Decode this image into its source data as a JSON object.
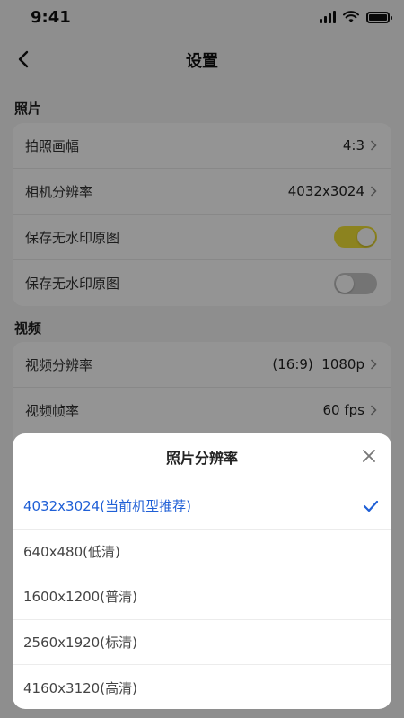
{
  "status_bar": {
    "time": "9:41"
  },
  "nav": {
    "title": "设置"
  },
  "photo_section": {
    "title": "照片",
    "rows": [
      {
        "label": "拍照画幅",
        "value": "4:3"
      },
      {
        "label": "相机分辨率",
        "value": "4032x3024"
      },
      {
        "label": "保存无水印原图",
        "toggle": "on"
      },
      {
        "label": "保存无水印原图",
        "toggle": "off"
      }
    ]
  },
  "video_section": {
    "title": "视频",
    "rows": [
      {
        "label": "视频分辨率",
        "value": "(16:9)  1080p"
      },
      {
        "label": "视频帧率",
        "value": "60 fps"
      }
    ]
  },
  "sheet": {
    "title": "照片分辨率",
    "options": [
      {
        "label": "4032x3024(当前机型推荐)",
        "selected": true
      },
      {
        "label": "640x480(低清)",
        "selected": false
      },
      {
        "label": "1600x1200(普清)",
        "selected": false
      },
      {
        "label": "2560x1920(标清)",
        "selected": false
      },
      {
        "label": "4160x3120(高清)",
        "selected": false
      }
    ]
  },
  "colors": {
    "toggle_on": "#f2e236",
    "toggle_off": "#c9c9c9",
    "selected": "#1f5fd6",
    "overlay": "rgba(0,0,0,0.42)"
  },
  "icons": [
    "signal-icon",
    "wifi-icon",
    "battery-icon",
    "back-arrow-icon",
    "chevron-right-icon",
    "close-icon",
    "checkmark-icon"
  ]
}
